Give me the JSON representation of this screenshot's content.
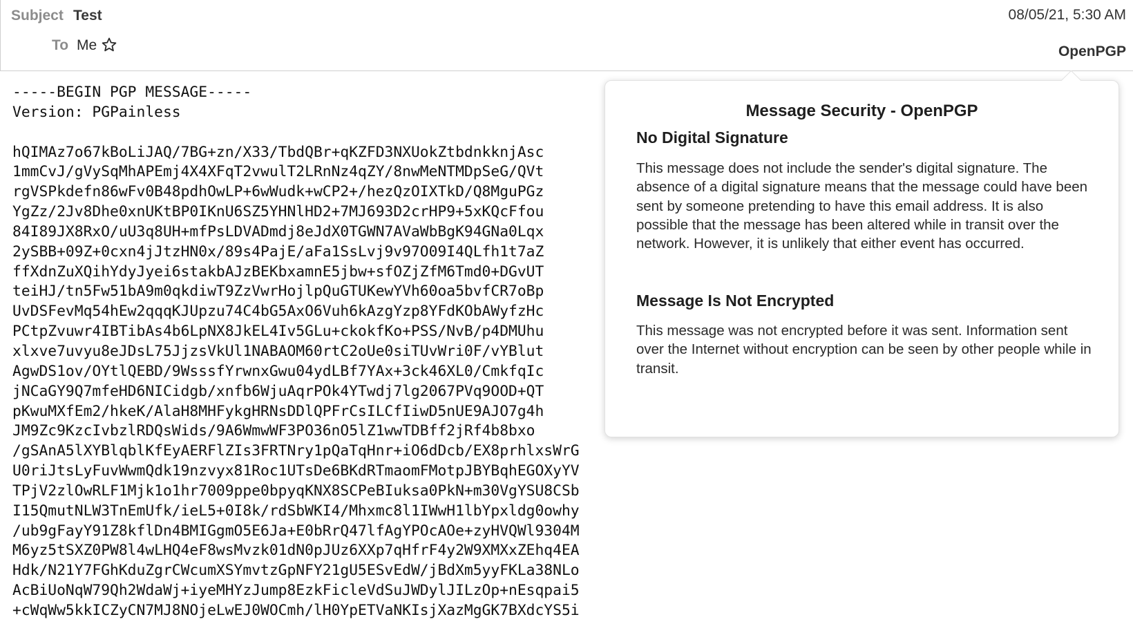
{
  "header": {
    "subject_label": "Subject",
    "subject_value": "Test",
    "to_label": "To",
    "to_value": "Me",
    "date": "08/05/21, 5:30 AM",
    "security_button": "OpenPGP"
  },
  "message": {
    "lines": [
      "-----BEGIN PGP MESSAGE-----",
      "Version: PGPainless",
      "",
      "hQIMAz7o67kBoLiJAQ/7BG+zn/X33/TbdQBr+qKZFD3NXUokZtbdnkknjAsc",
      "1mmCvJ/gVySqMhAPEmj4X4XFqT2vwulT2LRnNz4qZY/8nwMeNTMDpSeG/QVt",
      "rgVSPkdefn86wFv0B48pdhOwLP+6wWudk+wCP2+/hezQzOIXTkD/Q8MguPGz",
      "YgZz/2Jv8Dhe0xnUKtBP0IKnU6SZ5YHNlHD2+7MJ693D2crHP9+5xKQcFfou",
      "84I89JX8RxO/uU3q8UH+mfPsLDVADmdj8eJdX0TGWN7AVaWbBgK94GNa0Lqx",
      "2ySBB+09Z+0cxn4jJtzHN0x/89s4PajE/aFa1SsLvj9v97O09I4QLfh1t7aZ",
      "ffXdnZuXQihYdyJyei6stakbAJzBEKbxamnE5jbw+sfOZjZfM6Tmd0+DGvUT",
      "teiHJ/tn5Fw51bA9m0qkdiwT9ZzVwrHojlpQuGTUKewYVh60oa5bvfCR7oBp",
      "UvDSFevMq54hEw2qqqKJUpzu74C4bG5AxO6Vuh6kAzgYzp8YFdKObAWyfzHc",
      "PCtpZvuwr4IBTibAs4b6LpNX8JkEL4Iv5GLu+ckokfKo+PSS/NvB/p4DMUhu",
      "xlxve7uvyu8eJDsL75JjzsVkUl1NABAOM60rtC2oUe0siTUvWri0F/vYBlut",
      "AgwDS1ov/OYtlQEBD/9WsssfYrwnxGwu04ydLBf7YAx+3ck46XL0/CmkfqIc",
      "jNCaGY9Q7mfeHD6NICidgb/xnfb6WjuAqrPOk4YTwdj7lg2067PVq9OOD+QT",
      "pKwuMXfEm2/hkeK/AlaH8MHFykgHRNsDDlQPFrCsILCfIiwD5nUE9AJO7g4h",
      "JM9Zc9KzcIvbzlRDQsWids/9A6WmwWF3PO36nO5lZ1wwTDBff2jRf4b8bxo",
      "/gSAnA5lXYBlqblKfEyAERFlZIs3FRTNry1pQaTqHnr+iO6dDcb/EX8prhlxsWrG",
      "U0riJtsLyFuvWwmQdk19nzvyx81Roc1UTsDe6BKdRTmaomFMotpJBYBqhEGOXyYV",
      "TPjV2zlOwRLF1Mjk1o1hr7009ppe0bpyqKNX8SCPeBIuksa0PkN+m30VgYSU8CSb",
      "I15QmutNLW3TnEmUfk/ieL5+0I8k/rdSbWKI4/Mhxmc8l1IWwH1lbYpxldg0owhy",
      "/ub9gFayY91Z8kflDn4BMIGgmO5E6Ja+E0bRrQ47lfAgYPOcAOe+zyHVQWl9304M",
      "M6yz5tSXZ0PW8l4wLHQ4eF8wsMvzk01dN0pJUz6XXp7qHfrF4y2W9XMXxZEhq4EA",
      "Hdk/N21Y7FGhKduZgrCWcumXSYmvtzGpNFY21gU5ESvEdW/jBdXm5yyFKLa38NLo",
      "AcBiUoNqW79Qh2WdaWj+iyeMHYzJump8EzkFicleVdSuJWDylJILzOp+nEsqpai5",
      "+cWqWw5kkICZyCN7MJ8NOjeLwEJ0WOCmh/lH0YpETVaNKIsjXazMgGK7BXdcYS5i"
    ]
  },
  "popup": {
    "title": "Message Security - OpenPGP",
    "signature_heading": "No Digital Signature",
    "signature_text": "This message does not include the sender's digital signature. The absence of a digital signature means that the message could have been sent by someone pretending to have this email address. It is also possible that the message has been altered while in transit over the network. However, it is unlikely that either event has occurred.",
    "encryption_heading": "Message Is Not Encrypted",
    "encryption_text": "This message was not encrypted before it was sent. Information sent over the Internet without encryption can be seen by other people while in transit."
  },
  "icons": {
    "star": "star-outline-icon"
  }
}
